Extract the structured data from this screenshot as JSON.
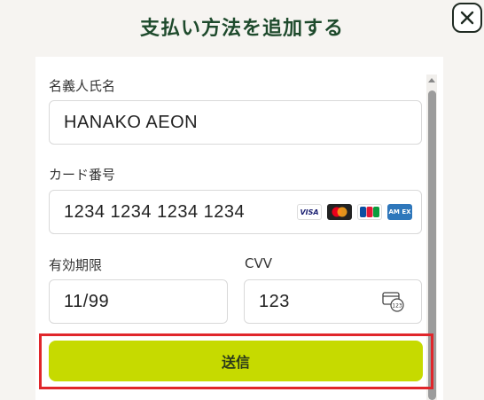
{
  "dialog": {
    "title": "支払い方法を追加する"
  },
  "form": {
    "name": {
      "label": "名義人氏名",
      "value": "HANAKO AEON"
    },
    "card": {
      "label": "カード番号",
      "value": "1234 1234 1234 1234",
      "brands": [
        {
          "id": "visa",
          "text": "VISA"
        },
        {
          "id": "mastercard",
          "text": ""
        },
        {
          "id": "jcb",
          "text": "JCB"
        },
        {
          "id": "amex",
          "text": "AM EX"
        }
      ]
    },
    "expiry": {
      "label": "有効期限",
      "value": "11/99"
    },
    "cvv": {
      "label": "CVV",
      "value": "123",
      "icon_text": "123"
    }
  },
  "submit": {
    "label": "送信"
  },
  "colors": {
    "title": "#1e4a2c",
    "submit_bg": "#c6da00",
    "highlight": "#e0262b"
  }
}
